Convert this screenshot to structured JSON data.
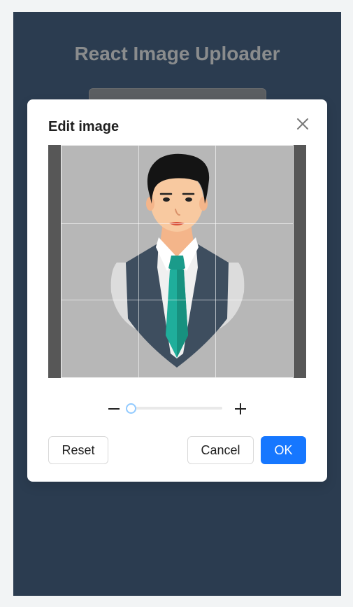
{
  "app": {
    "title": "React Image Uploader"
  },
  "modal": {
    "title": "Edit image",
    "close_icon": "close-icon"
  },
  "zoom": {
    "value": 0,
    "min": 0,
    "max": 1,
    "minus_icon": "minus-icon",
    "plus_icon": "plus-icon"
  },
  "actions": {
    "reset_label": "Reset",
    "cancel_label": "Cancel",
    "ok_label": "OK"
  },
  "colors": {
    "background": "#2b3c50",
    "primary": "#1677ff",
    "slider": "#91caff"
  }
}
